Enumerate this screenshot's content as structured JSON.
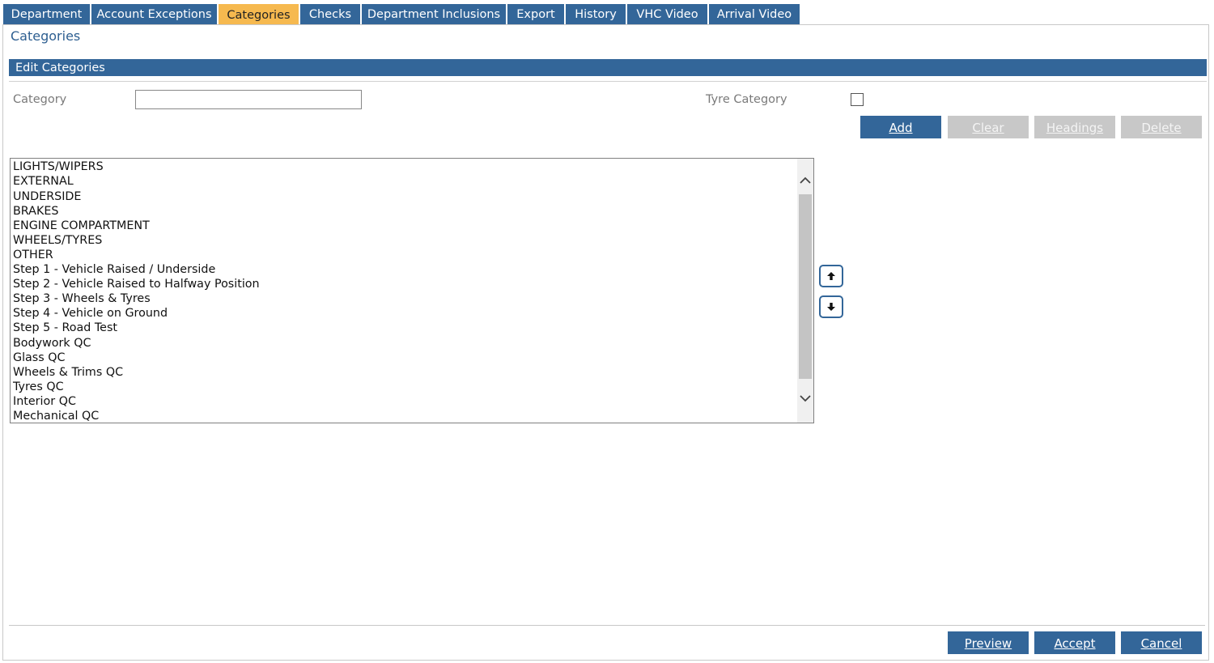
{
  "tabs": [
    {
      "label": "Department"
    },
    {
      "label": "Account Exceptions"
    },
    {
      "label": "Categories"
    },
    {
      "label": "Checks"
    },
    {
      "label": "Department Inclusions"
    },
    {
      "label": "Export"
    },
    {
      "label": "History"
    },
    {
      "label": "VHC Video"
    },
    {
      "label": "Arrival Video"
    }
  ],
  "active_tab": "Categories",
  "page_title": "Categories",
  "section": {
    "title": "Edit Categories"
  },
  "form": {
    "category_label": "Category",
    "category_value": "",
    "tyre_category_label": "Tyre Category",
    "tyre_category_checked": false
  },
  "actions": {
    "add": "Add",
    "clear": "Clear",
    "headings": "Headings",
    "delete": "Delete"
  },
  "categories": [
    "LIGHTS/WIPERS",
    "EXTERNAL",
    "UNDERSIDE",
    "BRAKES",
    "ENGINE COMPARTMENT",
    "WHEELS/TYRES",
    "OTHER",
    "Step 1 - Vehicle Raised / Underside",
    "Step 2 - Vehicle Raised to Halfway Position",
    "Step 3 - Wheels & Tyres",
    "Step 4 - Vehicle on Ground",
    "Step 5 - Road Test",
    "Bodywork QC",
    "Glass QC",
    "Wheels & Trims QC",
    "Tyres QC",
    "Interior QC",
    "Mechanical QC"
  ],
  "footer": {
    "preview": "Preview",
    "accept": "Accept",
    "cancel": "Cancel"
  },
  "colors": {
    "primary": "#336699",
    "active_tab": "#f6b94f",
    "disabled": "#c8c8c8"
  },
  "icons": {
    "up": "arrow-up-icon",
    "down": "arrow-down-icon",
    "scroll_up": "chevron-up-icon",
    "scroll_down": "chevron-down-icon"
  }
}
